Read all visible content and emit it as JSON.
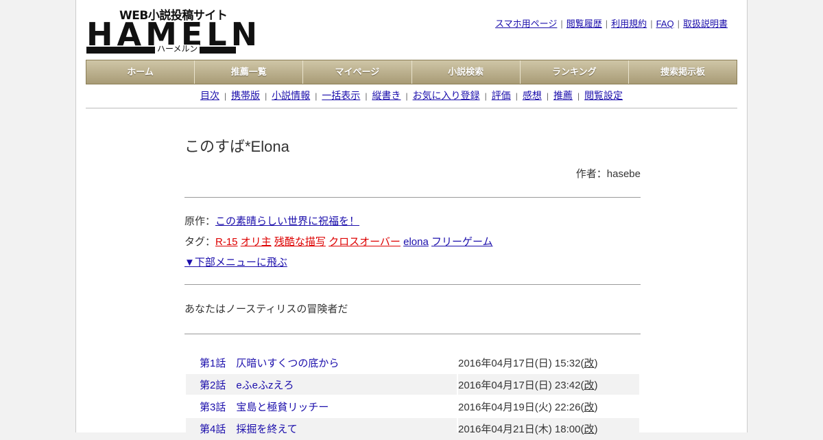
{
  "logo": {
    "tagline": "WEB小説投稿サイト",
    "main": "HAMELN",
    "kana": "ハーメルン"
  },
  "top_links": [
    "スマホ用ページ",
    "閲覧履歴",
    "利用規約",
    "FAQ",
    "取扱説明書"
  ],
  "main_nav": [
    "ホーム",
    "推薦一覧",
    "マイページ",
    "小説検索",
    "ランキング",
    "捜索掲示板"
  ],
  "sub_nav": [
    "目次",
    "携帯版",
    "小説情報",
    "一括表示",
    "縦書き",
    "お気に入り登録",
    "評価",
    "感想",
    "推薦",
    "閲覧設定"
  ],
  "novel": {
    "title": "このすば*Elona",
    "author": "作者：hasebe",
    "original_label": "原作：",
    "original_work": "この素晴らしい世界に祝福を！",
    "tags_label": "タグ：",
    "tags": [
      {
        "text": "R-15",
        "color": "#dd0000"
      },
      {
        "text": "オリ主",
        "color": "#dd0000"
      },
      {
        "text": "残酷な描写",
        "color": "#dd0000"
      },
      {
        "text": "クロスオーバー",
        "color": "#dd0000"
      },
      {
        "text": "elona",
        "color": "#1a0dab"
      },
      {
        "text": "フリーゲーム",
        "color": "#1a0dab"
      }
    ],
    "jump_link": "▼下部メニューに飛ぶ",
    "summary": "あなたはノースティリスの冒険者だ"
  },
  "chapters": [
    {
      "title": "第1話　仄暗いすくつの底から",
      "date": "2016年04月17日(日) 15:32",
      "rev": "改"
    },
    {
      "title": "第2話　eふeふzえろ",
      "date": "2016年04月17日(日) 23:42",
      "rev": "改"
    },
    {
      "title": "第3話　宝島と極貧リッチー",
      "date": "2016年04月19日(火) 22:26",
      "rev": "改"
    },
    {
      "title": "第4話　採掘を終えて",
      "date": "2016年04月21日(木) 18:00",
      "rev": "改"
    }
  ],
  "colors": {
    "link": "#1a0dab",
    "tag_red": "#dd0000",
    "nav_gradient_top": "#cfc6a7",
    "nav_gradient_bottom": "#a89b76"
  }
}
